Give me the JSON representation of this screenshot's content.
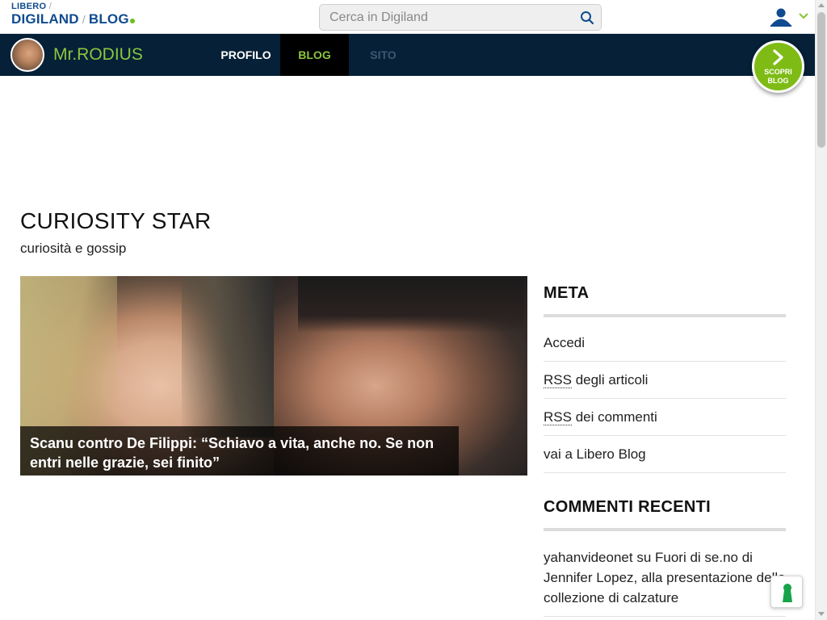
{
  "header": {
    "logo_top": "LIBERO",
    "logo_top_sep": "/",
    "logo_main": "DIGILAND",
    "logo_sep": "/",
    "logo_blog": "BLOG",
    "search_placeholder": "Cerca in Digiland",
    "search_icon": "search-icon",
    "user_icon": "user-icon",
    "chevron_icon": "chevron-down-icon",
    "accent_color": "#8cc63f",
    "brand_color": "#0f4b8f"
  },
  "nav": {
    "username": "Mr.RODIUS",
    "tabs": [
      {
        "label": "PROFILO"
      },
      {
        "label": "BLOG"
      },
      {
        "label": "SITO"
      }
    ],
    "active_tab": "BLOG",
    "bar_color": "#052037",
    "scopri_line1": "SCOPRI",
    "scopri_line2": "BLOG"
  },
  "blog": {
    "title": "CURIOSITY STAR",
    "description": "curiosità e gossip",
    "featured_caption": "Scanu contro De Filippi: “Schiavo a vita, anche no. Se non entri nelle grazie, sei finito”"
  },
  "sidebar": {
    "meta_title": "META",
    "meta_items": [
      {
        "label": "Accedi"
      },
      {
        "abbr": "RSS",
        "label": " degli articoli"
      },
      {
        "abbr": "RSS",
        "label": " dei commenti"
      },
      {
        "label": "vai a Libero Blog"
      }
    ],
    "comments_title": "COMMENTI RECENTI",
    "comments": [
      {
        "text": "yahanvideonet su Fuori di se.no di Jennifer Lopez, alla presentazione della collezione di calzature"
      }
    ]
  }
}
